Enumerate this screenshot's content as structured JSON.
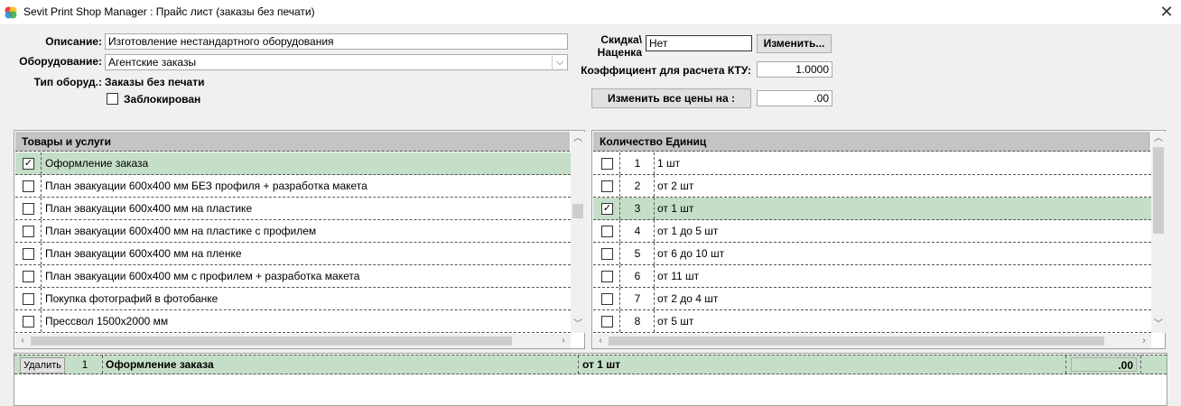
{
  "window": {
    "title": "Sevit Print Shop Manager : Прайс лист (заказы без печати)"
  },
  "form": {
    "description_label": "Описание:",
    "description_value": "Изготовление нестандартного оборудования",
    "equipment_label": "Оборудование:",
    "equipment_value": "Агентские заказы",
    "equip_type_label": "Тип оборуд.:",
    "equip_type_value": "Заказы без печати",
    "locked_label": "Заблокирован",
    "discount_label_1": "Скидка\\",
    "discount_label_2": "Наценка",
    "discount_value": "Нет",
    "change_button": "Изменить...",
    "ktu_label": "Коэффициент для расчета КТУ:",
    "ktu_value": "1.0000",
    "change_all_button": "Изменить все цены на :",
    "change_all_value": ".00"
  },
  "products": {
    "header": "Товары и услуги",
    "items": [
      {
        "label": "Оформление заказа",
        "checked": true
      },
      {
        "label": "План эвакуации 600х400 мм БЕЗ профиля + разработка макета",
        "checked": false
      },
      {
        "label": "План эвакуации 600х400 мм на пластике",
        "checked": false
      },
      {
        "label": "План эвакуации 600х400 мм на пластике с профилем",
        "checked": false
      },
      {
        "label": "План эвакуации 600х400 мм на пленке",
        "checked": false
      },
      {
        "label": "План эвакуации 600х400 мм с профилем + разработка макета",
        "checked": false
      },
      {
        "label": "Покупка фотографий в фотобанке",
        "checked": false
      },
      {
        "label": "Прессвол 1500х2000 мм",
        "checked": false
      }
    ]
  },
  "quantities": {
    "header": "Количество Единиц",
    "items": [
      {
        "num": "1",
        "label": "1 шт",
        "checked": false
      },
      {
        "num": "2",
        "label": "от 2 шт",
        "checked": false
      },
      {
        "num": "3",
        "label": "от 1 шт",
        "checked": true
      },
      {
        "num": "4",
        "label": "от 1 до 5 шт",
        "checked": false
      },
      {
        "num": "5",
        "label": "от 6 до 10 шт",
        "checked": false
      },
      {
        "num": "6",
        "label": "от 11 шт",
        "checked": false
      },
      {
        "num": "7",
        "label": "от 2 до 4 шт",
        "checked": false
      },
      {
        "num": "8",
        "label": "от 5 шт",
        "checked": false
      }
    ]
  },
  "selection": {
    "delete_button": "Удалить",
    "num": "1",
    "product": "Оформление заказа",
    "quantity": "от 1 шт",
    "price": ".00"
  },
  "colors": {
    "selected_row": "#c5dec8",
    "header": "#c4c4c4"
  }
}
